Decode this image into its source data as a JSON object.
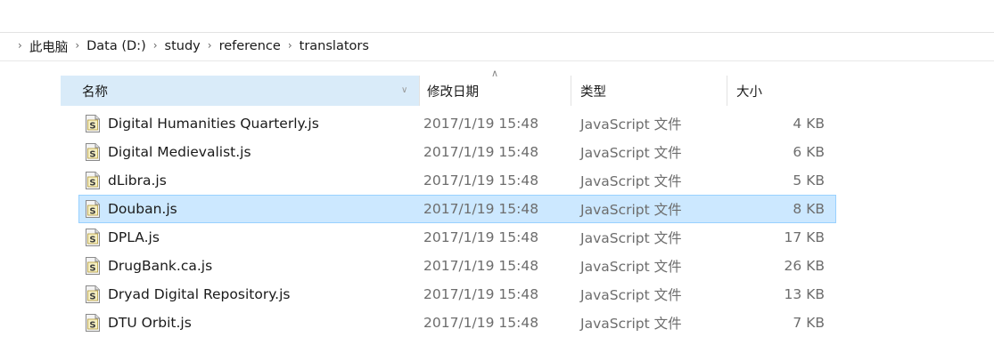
{
  "address": {
    "segments": [
      "此电脑",
      "Data (D:)",
      "study",
      "reference",
      "translators"
    ]
  },
  "columns": {
    "name": "名称",
    "date": "修改日期",
    "type": "类型",
    "size": "大小"
  },
  "files": [
    {
      "name": "Digital Humanities Quarterly.js",
      "date": "2017/1/19 15:48",
      "type": "JavaScript 文件",
      "size": "4 KB"
    },
    {
      "name": "Digital Medievalist.js",
      "date": "2017/1/19 15:48",
      "type": "JavaScript 文件",
      "size": "6 KB"
    },
    {
      "name": "dLibra.js",
      "date": "2017/1/19 15:48",
      "type": "JavaScript 文件",
      "size": "5 KB"
    },
    {
      "name": "Douban.js",
      "date": "2017/1/19 15:48",
      "type": "JavaScript 文件",
      "size": "8 KB",
      "selected": true
    },
    {
      "name": "DPLA.js",
      "date": "2017/1/19 15:48",
      "type": "JavaScript 文件",
      "size": "17 KB"
    },
    {
      "name": "DrugBank.ca.js",
      "date": "2017/1/19 15:48",
      "type": "JavaScript 文件",
      "size": "26 KB"
    },
    {
      "name": "Dryad Digital Repository.js",
      "date": "2017/1/19 15:48",
      "type": "JavaScript 文件",
      "size": "13 KB"
    },
    {
      "name": "DTU Orbit.js",
      "date": "2017/1/19 15:48",
      "type": "JavaScript 文件",
      "size": "7 KB"
    }
  ],
  "icons": {
    "file": "js-file-icon",
    "chevron": "chevron-right-icon",
    "sort": "chevron-up-icon",
    "header_dropdown": "chevron-down-icon"
  },
  "colors": {
    "selected_bg": "#cce8ff",
    "selected_border": "#99d1ff",
    "header_bg": "#d9ebf9"
  }
}
